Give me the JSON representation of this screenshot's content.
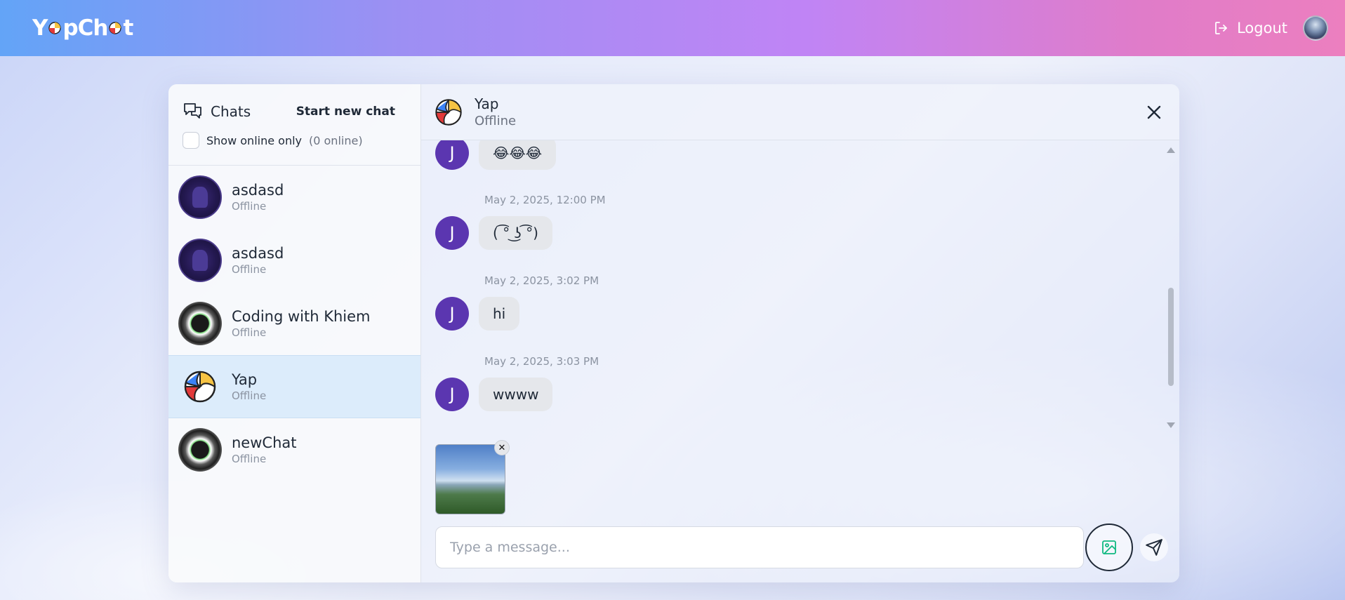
{
  "navbar": {
    "logo_text_1": "Y",
    "logo_text_2": "pCh",
    "logo_text_3": "t",
    "logout_label": "Logout"
  },
  "sidebar": {
    "title": "Chats",
    "start_new_label": "Start new chat",
    "show_online_label": "Show online only",
    "online_count": "(0 online)",
    "items": [
      {
        "name": "asdasd",
        "status": "Offline",
        "avatar": "witch-avatar"
      },
      {
        "name": "asdasd",
        "status": "Offline",
        "avatar": "witch-avatar"
      },
      {
        "name": "Coding with Khiem",
        "status": "Offline",
        "avatar": "swirl-avatar"
      },
      {
        "name": "Yap",
        "status": "Offline",
        "avatar": "beach-ball-avatar"
      },
      {
        "name": "newChat",
        "status": "Offline",
        "avatar": "swirl-avatar"
      }
    ]
  },
  "chat": {
    "header_name": "Yap",
    "header_status": "Offline",
    "messages": [
      {
        "sender_initial": "J",
        "text": "😂😂😂",
        "timestamp": ""
      },
      {
        "sender_initial": "J",
        "text": "( ͡° ͜ʖ ͡°)",
        "timestamp": "May 2, 2025, 12:00 PM"
      },
      {
        "sender_initial": "J",
        "text": "hi",
        "timestamp": "May 2, 2025, 3:02 PM"
      },
      {
        "sender_initial": "J",
        "text": "wwww",
        "timestamp": "May 2, 2025, 3:03 PM"
      }
    ],
    "attachment_remove": "✕",
    "input_placeholder": "Type a message...",
    "input_value": ""
  },
  "colors": {
    "accent_purple": "#5b36b0",
    "active_item": "#dcecfb",
    "image_icon": "#10b981"
  }
}
